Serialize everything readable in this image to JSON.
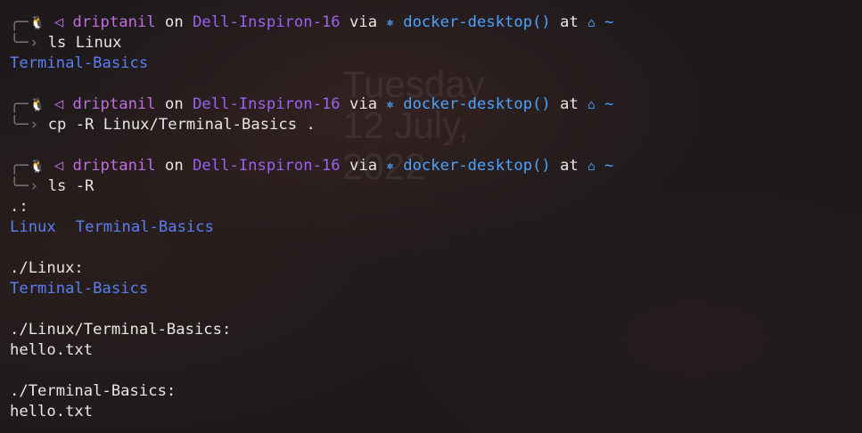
{
  "wallpaper": {
    "date_lines": [
      "Tuesday",
      "12 July,",
      "2022"
    ]
  },
  "prompt": {
    "user": "driptanil",
    "on_word": "on",
    "host": "Dell-Inspiron-16",
    "via_word": "via",
    "docker_context": "docker-desktop()",
    "at_word": "at",
    "path": "~",
    "icons": {
      "os": "linux-tux-icon",
      "arrow": "arrow-left-icon",
      "docker": "docker-wheel-icon",
      "home": "home-icon"
    },
    "colors": {
      "user": "#c06de0",
      "host": "#9a62f0",
      "docker": "#4aa3ff",
      "directory": "#5a7ff0"
    }
  },
  "session": {
    "block1": {
      "command": "ls Linux",
      "output": [
        "Terminal-Basics"
      ]
    },
    "block2": {
      "command": "cp -R Linux/Terminal-Basics ."
    },
    "block3": {
      "command": "ls -R",
      "root_header": ".:",
      "root_dirs": [
        "Linux",
        "Terminal-Basics"
      ],
      "linux_header": "./Linux:",
      "linux_dirs": [
        "Terminal-Basics"
      ],
      "linux_tb_header": "./Linux/Terminal-Basics:",
      "linux_tb_files": [
        "hello.txt"
      ],
      "tb_header": "./Terminal-Basics:",
      "tb_files": [
        "hello.txt"
      ]
    }
  }
}
